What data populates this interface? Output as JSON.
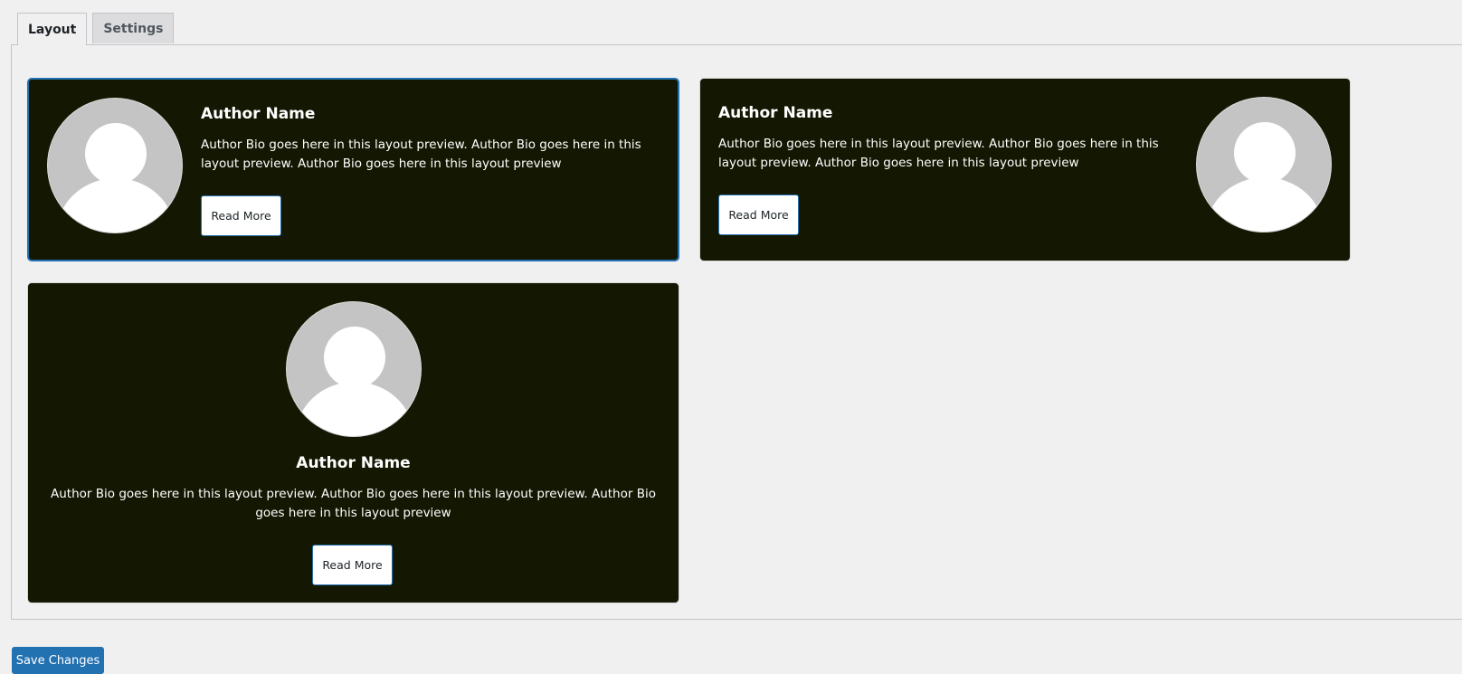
{
  "tabs": [
    {
      "label": "Layout",
      "active": true
    },
    {
      "label": "Settings",
      "active": false
    }
  ],
  "cards": [
    {
      "layout": "image-left",
      "selected": true,
      "name": "Author Name",
      "bio": "Author Bio goes here in this layout preview. Author Bio goes here in this layout preview. Author Bio goes here in this layout preview",
      "button": "Read More",
      "avatar_icon": "user-avatar-placeholder-icon"
    },
    {
      "layout": "image-right",
      "selected": false,
      "name": "Author Name",
      "bio": "Author Bio goes here in this layout preview. Author Bio goes here in this layout preview. Author Bio goes here in this layout preview",
      "button": "Read More",
      "avatar_icon": "user-avatar-placeholder-icon"
    },
    {
      "layout": "image-top-centered",
      "selected": false,
      "name": "Author Name",
      "bio": "Author Bio goes here in this layout preview. Author Bio goes here in this layout preview. Author Bio goes here in this layout preview",
      "button": "Read More",
      "avatar_icon": "user-avatar-placeholder-icon"
    }
  ],
  "save_button": "Save Changes",
  "colors": {
    "card_background": "#141802",
    "accent": "#2271b1",
    "page_background": "#f0f0f1",
    "avatar_background": "#c4c4c4"
  }
}
